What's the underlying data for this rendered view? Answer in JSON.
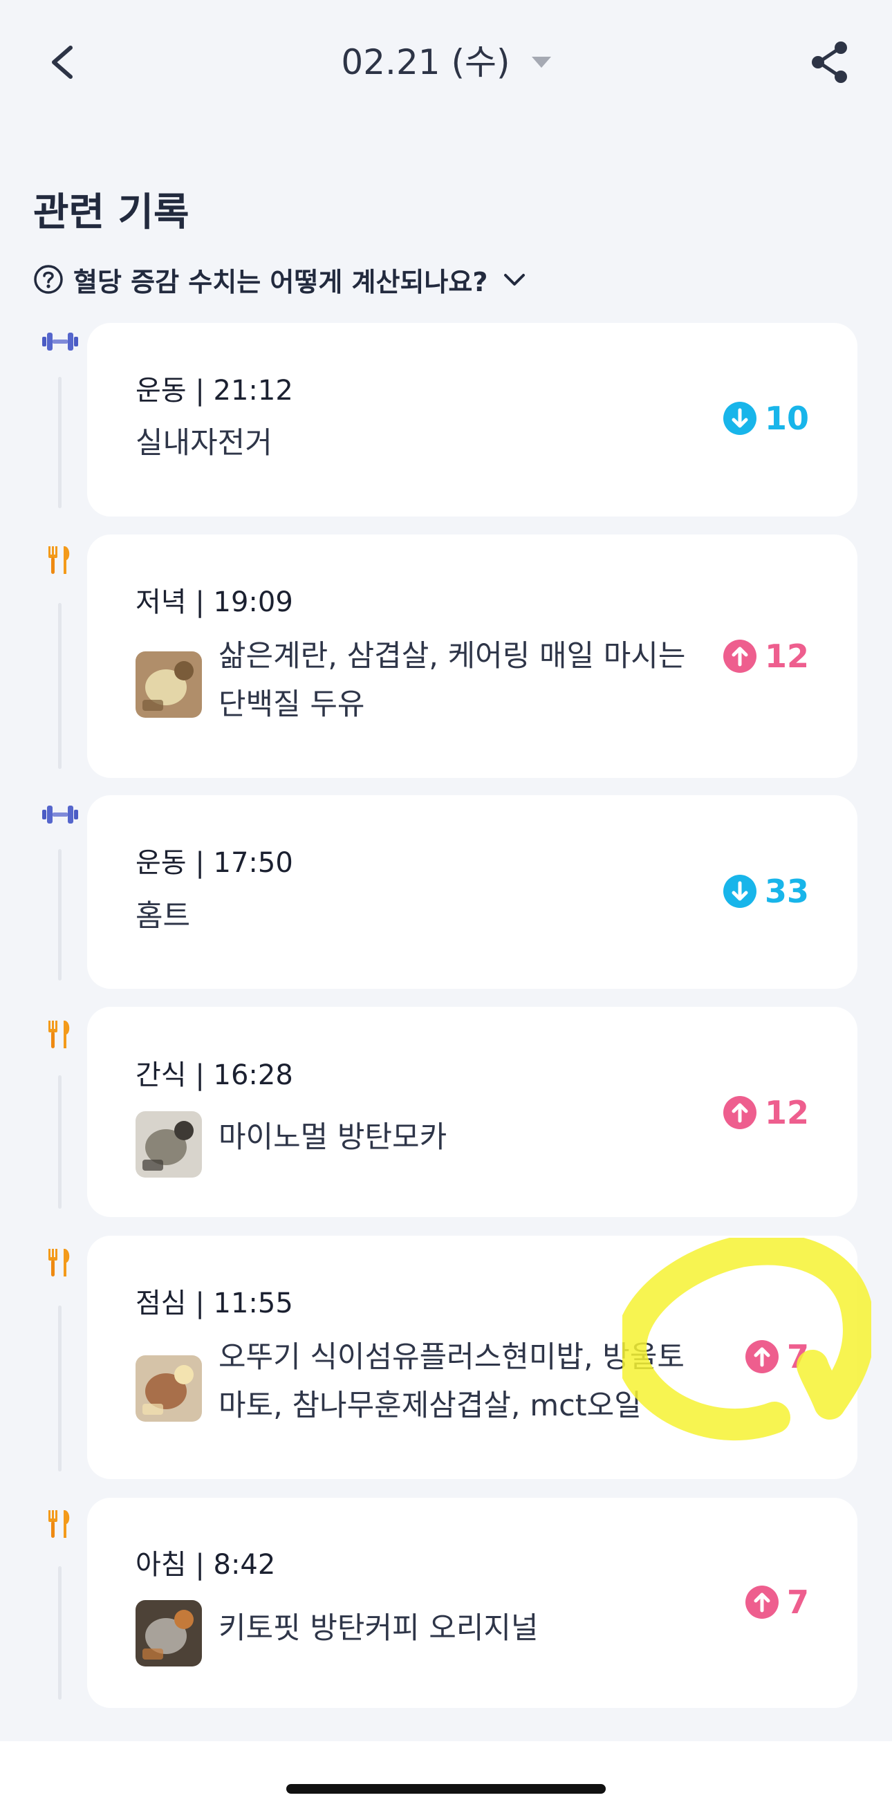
{
  "header": {
    "title": "02.21 (수)",
    "back_icon": "chevron-left-icon",
    "share_icon": "share-icon",
    "caret_icon": "caret-down-icon"
  },
  "section": {
    "title": "관련 기록",
    "help_text": "혈당 증감 수치는 어떻게 계산되나요?",
    "help_icon": "question-circle-icon",
    "help_chevron": "chevron-down-icon"
  },
  "records": [
    {
      "kind": "exercise",
      "icon": "dumbbell-icon",
      "header": "운동 | 21:12",
      "desc": "실내자전거",
      "has_photo": false,
      "direction": "down",
      "value": "10"
    },
    {
      "kind": "meal",
      "icon": "fork-knife-icon",
      "header": "저녁 | 19:09",
      "desc": "삶은계란, 삼겹살, 케어링 매일 마시는\n단백질 두유",
      "has_photo": true,
      "direction": "up",
      "value": "12"
    },
    {
      "kind": "exercise",
      "icon": "dumbbell-icon",
      "header": "운동 | 17:50",
      "desc": "홈트",
      "has_photo": false,
      "direction": "down",
      "value": "33"
    },
    {
      "kind": "meal",
      "icon": "fork-knife-icon",
      "header": "간식 | 16:28",
      "desc": "마이노멀 방탄모카",
      "has_photo": true,
      "direction": "up",
      "value": "12"
    },
    {
      "kind": "meal",
      "icon": "fork-knife-icon",
      "header": "점심 | 11:55",
      "desc": "오뚜기 식이섬유플러스현미밥, 방울토\n마토, 참나무훈제삼겹살, mct오일",
      "has_photo": true,
      "direction": "up",
      "value": "7"
    },
    {
      "kind": "meal",
      "icon": "fork-knife-icon",
      "header": "아침 | 8:42",
      "desc": "키토핏 방탄커피 오리지널",
      "has_photo": true,
      "direction": "up",
      "value": "7"
    }
  ],
  "colors": {
    "background": "#f3f5f9",
    "card": "#ffffff",
    "down": "#18b5ea",
    "up": "#ee5e8e",
    "dumbbell": "#5566cc",
    "fork": "#f39a1a",
    "highlight": "#f6f233"
  }
}
